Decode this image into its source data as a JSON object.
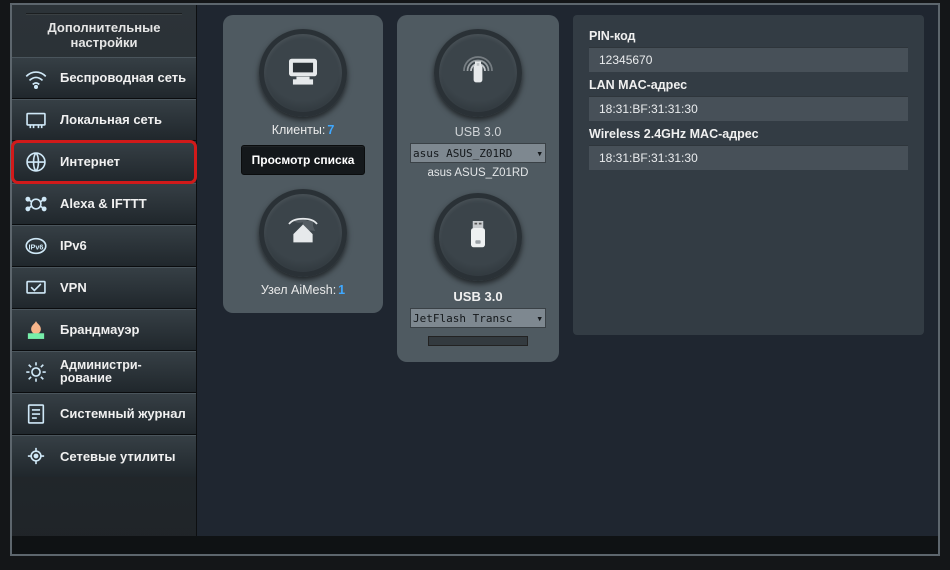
{
  "sidebar": {
    "title_line1": "Дополнительные",
    "title_line2": "настройки",
    "items": [
      {
        "label": "Беспроводная сеть"
      },
      {
        "label": "Локальная сеть"
      },
      {
        "label": "Интернет"
      },
      {
        "label": "Alexa & IFTTT"
      },
      {
        "label": "IPv6"
      },
      {
        "label": "VPN"
      },
      {
        "label": "Брандмауэр"
      },
      {
        "label": "Администри­рование"
      },
      {
        "label": "Системный журнал"
      },
      {
        "label": "Сетевые утилиты"
      }
    ]
  },
  "clients": {
    "label": "Клиенты:",
    "count": "7",
    "button": "Просмотр списка"
  },
  "aimesh": {
    "label": "Узел AiMesh:",
    "count": "1"
  },
  "usb1": {
    "port": "USB 3.0",
    "selected": "asus ASUS_Z01RD",
    "readout": "asus ASUS_Z01RD"
  },
  "usb2": {
    "port": "USB 3.0",
    "selected": "JetFlash Transc"
  },
  "info": {
    "pin_label": "PIN-код",
    "pin_value": "12345670",
    "lan_label": "LAN MAC-адрес",
    "lan_value": "18:31:BF:31:31:30",
    "wlan_label": "Wireless 2.4GHz MAC-адрес",
    "wlan_value": "18:31:BF:31:31:30"
  }
}
